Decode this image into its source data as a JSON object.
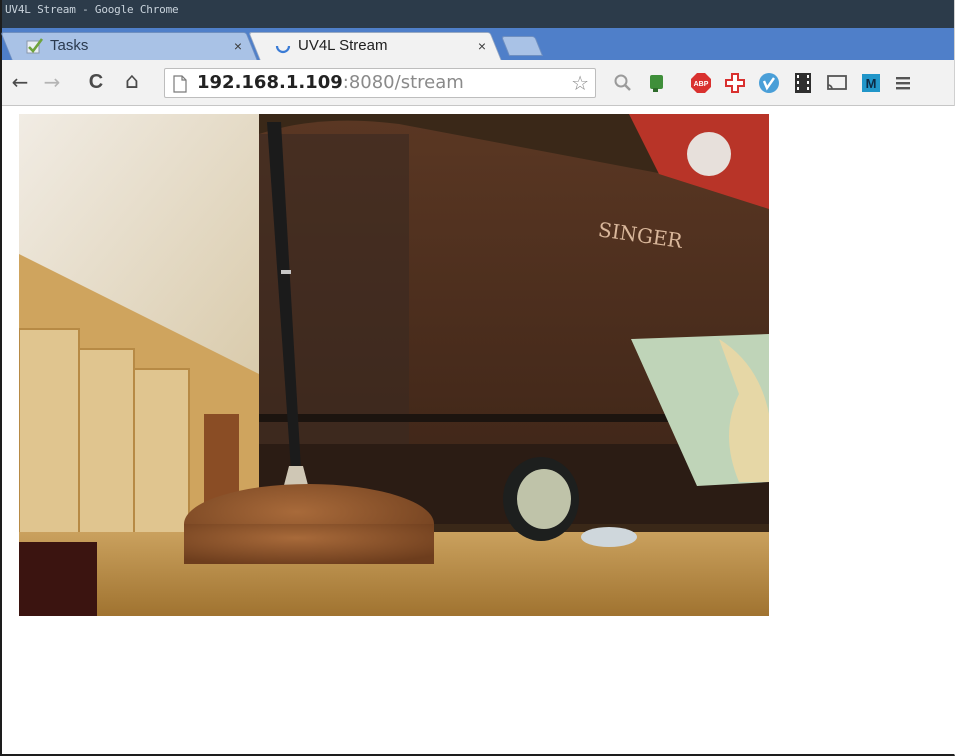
{
  "window": {
    "title": "UV4L Stream - Google Chrome"
  },
  "tabs": [
    {
      "label": "Tasks",
      "icon": "checkmark-icon",
      "active": false
    },
    {
      "label": "UV4L Stream",
      "icon": "loading-spinner-icon",
      "active": true
    }
  ],
  "tab_close_glyph": "×",
  "toolbar": {
    "back_glyph": "←",
    "forward_glyph": "→",
    "reload_glyph": "C",
    "home_glyph": "⌂"
  },
  "address": {
    "host": "192.168.1.109",
    "rest": ":8080/stream"
  },
  "extensions": [
    "star-bookmark-icon",
    "search-extension-icon",
    "evernote-icon",
    "adblock-plus-icon",
    "plus-cross-extension-icon",
    "vimeo-icon",
    "film-strip-icon",
    "cast-icon",
    "m-extension-icon",
    "menu-icon"
  ],
  "stream": {
    "content": "webcam-frame",
    "visible_brand_text": "SINGER"
  },
  "colors": {
    "titlebar": "#2c3b4a",
    "tabstrip": "#4f7fc9",
    "toolbar": "#f2f2f2"
  }
}
